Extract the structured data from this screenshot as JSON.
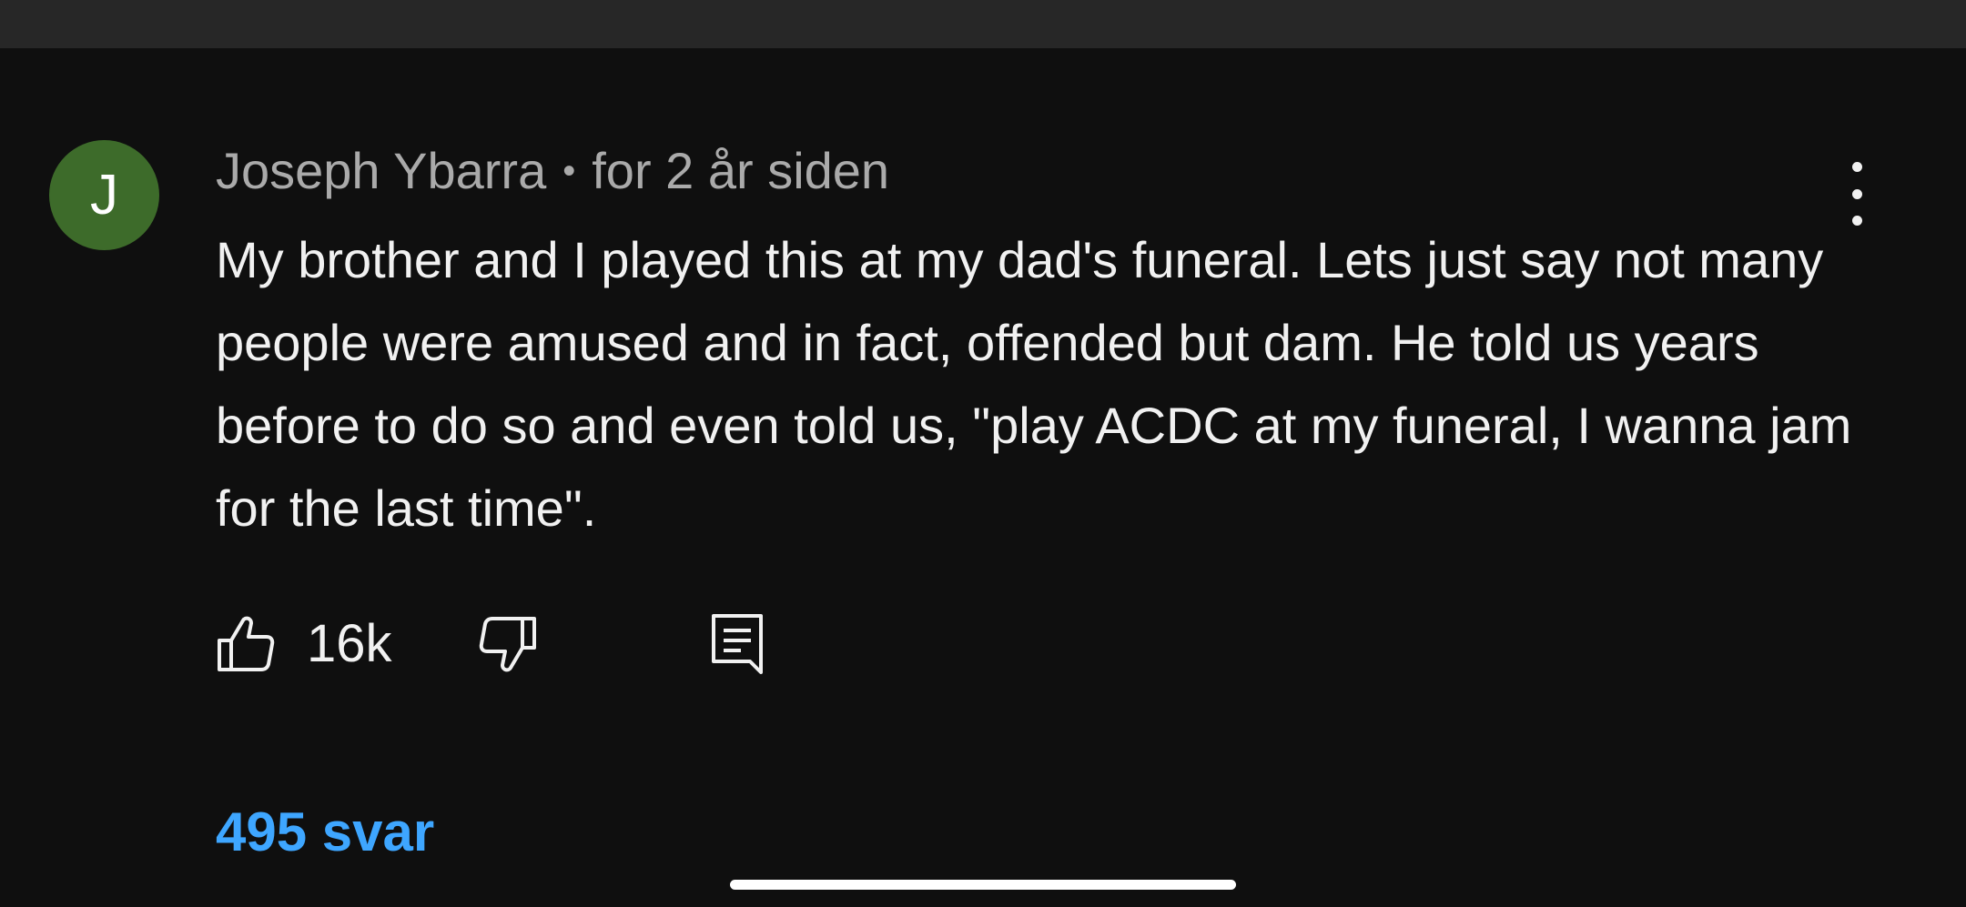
{
  "comment": {
    "avatar_letter": "J",
    "author": "Joseph Ybarra",
    "separator": "•",
    "timestamp": "for 2 år siden",
    "text": "My brother and I played this at my dad's funeral. Lets just say not many people were amused and in fact, offended but dam. He told us years before to do so and even told us, \"play ACDC at my funeral, I wanna jam for the last time\".",
    "like_count": "16k",
    "replies_label": "495 svar"
  },
  "colors": {
    "background": "#0f0f0f",
    "top_bar": "#272727",
    "avatar_bg": "#3d6b2a",
    "meta_text": "#aaaaaa",
    "body_text": "#f1f1f1",
    "link": "#3ea6ff"
  },
  "icons": {
    "more": "more-vertical-icon",
    "like": "thumbs-up-icon",
    "dislike": "thumbs-down-icon",
    "reply": "comment-reply-icon"
  }
}
